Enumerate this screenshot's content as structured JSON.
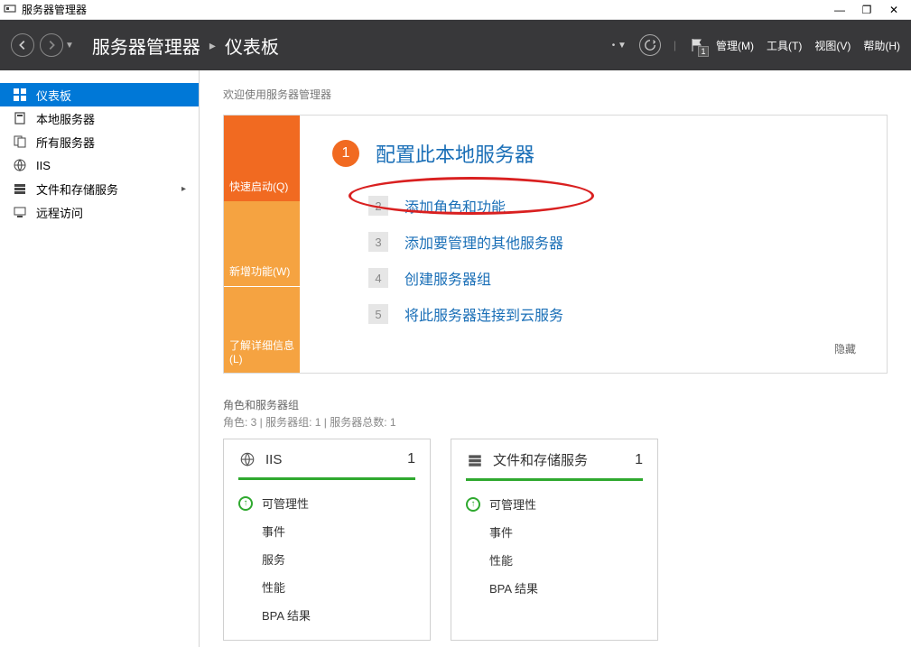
{
  "window": {
    "title": "服务器管理器",
    "minimize": "—",
    "maximize": "❐",
    "close": "✕"
  },
  "header": {
    "breadcrumb": [
      "服务器管理器",
      "仪表板"
    ],
    "flag_count": "1",
    "menus": [
      "管理(M)",
      "工具(T)",
      "视图(V)",
      "帮助(H)"
    ]
  },
  "sidebar": {
    "items": [
      {
        "label": "仪表板"
      },
      {
        "label": "本地服务器"
      },
      {
        "label": "所有服务器"
      },
      {
        "label": "IIS"
      },
      {
        "label": "文件和存储服务"
      },
      {
        "label": "远程访问"
      }
    ]
  },
  "welcome": {
    "title": "欢迎使用服务器管理器",
    "left_blocks": [
      "快速启动(Q)",
      "新增功能(W)",
      "了解详细信息(L)"
    ],
    "step1_num": "1",
    "step1_text": "配置此本地服务器",
    "steps": [
      {
        "num": "2",
        "text": "添加角色和功能"
      },
      {
        "num": "3",
        "text": "添加要管理的其他服务器"
      },
      {
        "num": "4",
        "text": "创建服务器组"
      },
      {
        "num": "5",
        "text": "将此服务器连接到云服务"
      }
    ],
    "hide": "隐藏"
  },
  "roles": {
    "title": "角色和服务器组",
    "subtitle": "角色: 3 | 服务器组: 1 | 服务器总数: 1",
    "tiles": [
      {
        "name": "IIS",
        "count": "1",
        "rows": [
          "可管理性",
          "事件",
          "服务",
          "性能",
          "BPA 结果"
        ]
      },
      {
        "name": "文件和存储服务",
        "count": "1",
        "rows": [
          "可管理性",
          "事件",
          "性能",
          "BPA 结果"
        ]
      }
    ]
  }
}
